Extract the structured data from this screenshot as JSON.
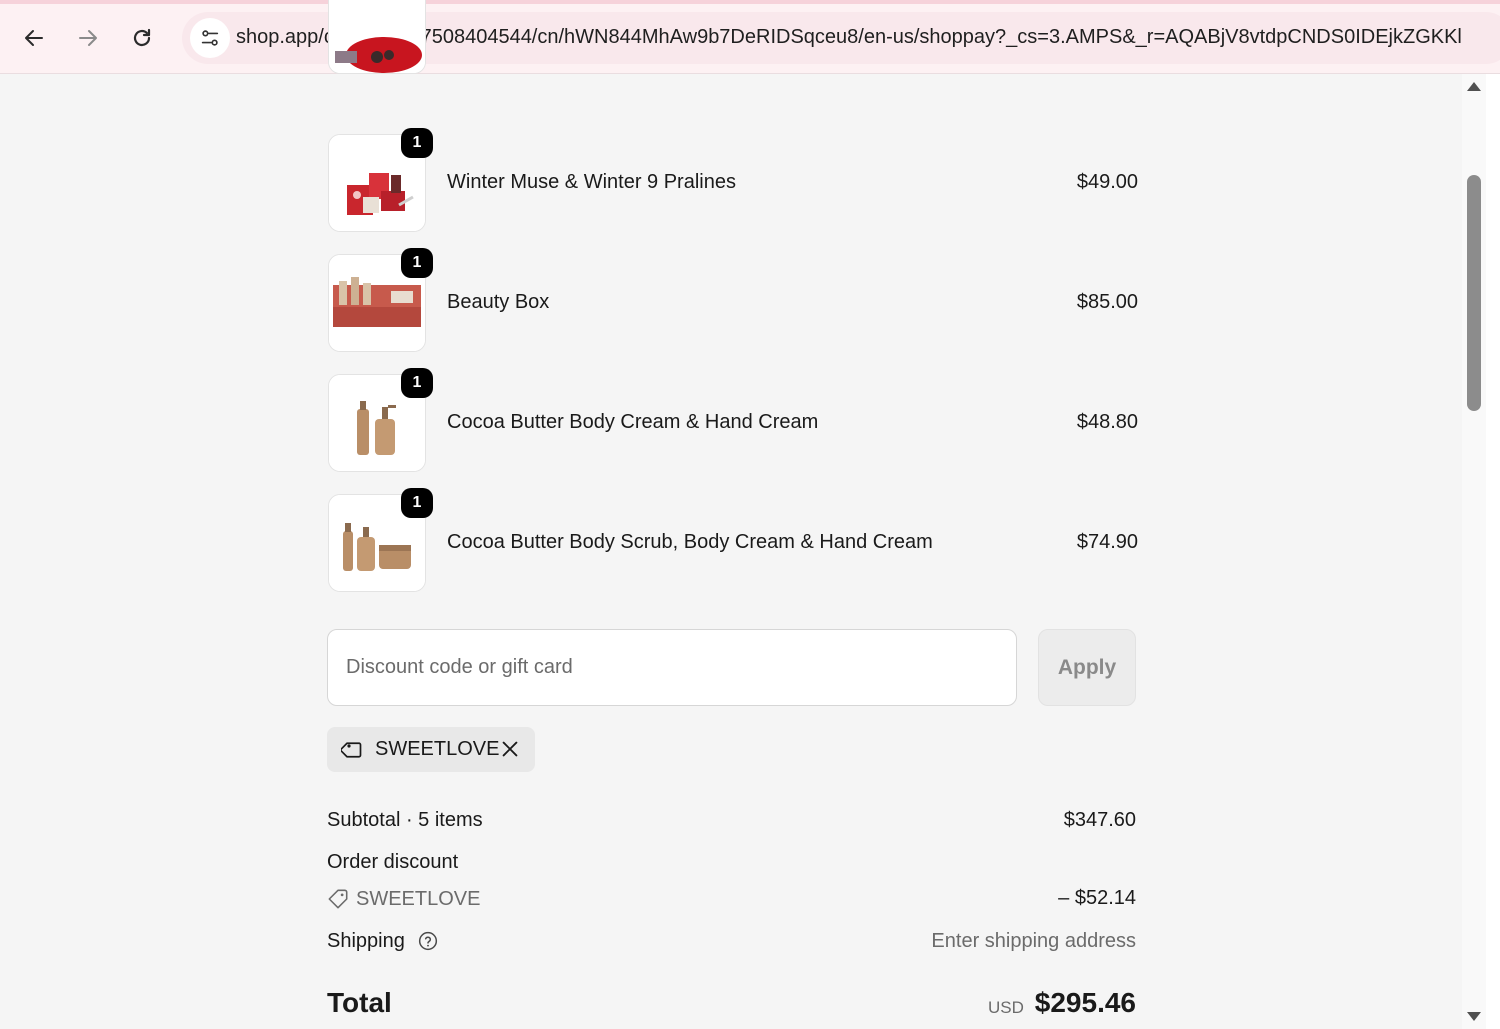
{
  "browser": {
    "url": "shop.app/checkout/67508404544/cn/hWN844MhAw9b7DeRIDSqceu8/en-us/shoppay?_cs=3.AMPS&_r=AQABjV8vtdpCNDS0IDEjkZGKKl",
    "back_icon": "arrow-left-icon",
    "forward_icon": "arrow-right-icon",
    "reload_icon": "reload-icon",
    "site_info_icon": "tune-icon"
  },
  "items": [
    {
      "name": "Winter Muse & Winter 9 Pralines",
      "price": "$49.00",
      "qty": "1"
    },
    {
      "name": "Beauty Box",
      "price": "$85.00",
      "qty": "1"
    },
    {
      "name": "Cocoa Butter Body Cream & Hand Cream",
      "price": "$48.80",
      "qty": "1"
    },
    {
      "name": "Cocoa Butter Body Scrub, Body Cream & Hand Cream",
      "price": "$74.90",
      "qty": "1"
    }
  ],
  "discount": {
    "placeholder": "Discount code or gift card",
    "apply_label": "Apply",
    "applied_code": "SWEETLOVE"
  },
  "summary": {
    "subtotal_label": "Subtotal · 5 items",
    "subtotal_value": "$347.60",
    "order_discount_label": "Order discount",
    "discount_code": "SWEETLOVE",
    "discount_value": "– $52.14",
    "shipping_label": "Shipping",
    "shipping_value": "Enter shipping address",
    "total_label": "Total",
    "total_currency": "USD",
    "total_value": "$295.46"
  },
  "colors": {
    "chrome_bg": "#fdf1f3",
    "page_bg": "#f5f5f5",
    "badge_bg": "#000000",
    "muted_text": "#6b6b6b"
  }
}
